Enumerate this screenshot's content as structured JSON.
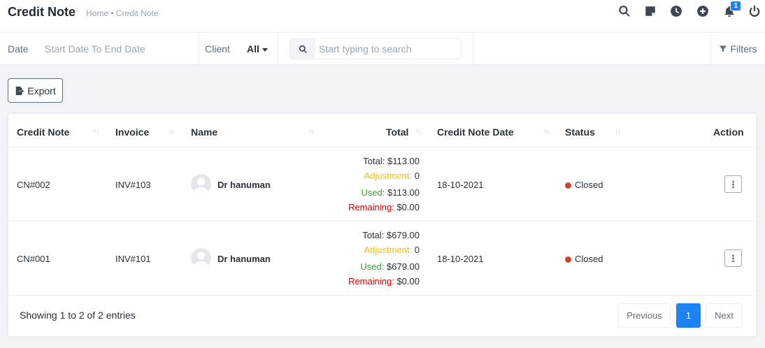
{
  "header": {
    "title": "Credit Note",
    "breadcrumb": "Home • Credit Note",
    "notification_count": "1"
  },
  "filters": {
    "date_label": "Date",
    "date_placeholder": "Start Date To End Date",
    "client_label": "Client",
    "client_value": "All",
    "search_placeholder": "Start typing to search",
    "filters_label": "Filters"
  },
  "toolbar": {
    "export_label": "Export"
  },
  "table": {
    "columns": [
      "Credit Note",
      "Invoice",
      "Name",
      "Total",
      "Credit Note Date",
      "Status",
      "Action"
    ],
    "rows": [
      {
        "credit_note": "CN#002",
        "invoice": "INV#103",
        "name": "Dr hanuman",
        "total_label": "Total:",
        "total": "$113.00",
        "adjustment_label": "Adjustment:",
        "adjustment": "0",
        "used_label": "Used:",
        "used": "$113.00",
        "remaining_label": "Remaining:",
        "remaining": "$0.00",
        "date": "18-10-2021",
        "status": "Closed"
      },
      {
        "credit_note": "CN#001",
        "invoice": "INV#101",
        "name": "Dr hanuman",
        "total_label": "Total:",
        "total": "$679.00",
        "adjustment_label": "Adjustment:",
        "adjustment": "0",
        "used_label": "Used:",
        "used": "$679.00",
        "remaining_label": "Remaining:",
        "remaining": "$0.00",
        "date": "18-10-2021",
        "status": "Closed"
      }
    ]
  },
  "pagination": {
    "info": "Showing 1 to 2 of 2 entries",
    "previous": "Previous",
    "current": "1",
    "next": "Next"
  },
  "colors": {
    "accent": "#1d82f5",
    "status_closed": "#d0412d",
    "adjustment": "#fcbd01",
    "used": "#39a32f",
    "remaining": "#d30000"
  }
}
